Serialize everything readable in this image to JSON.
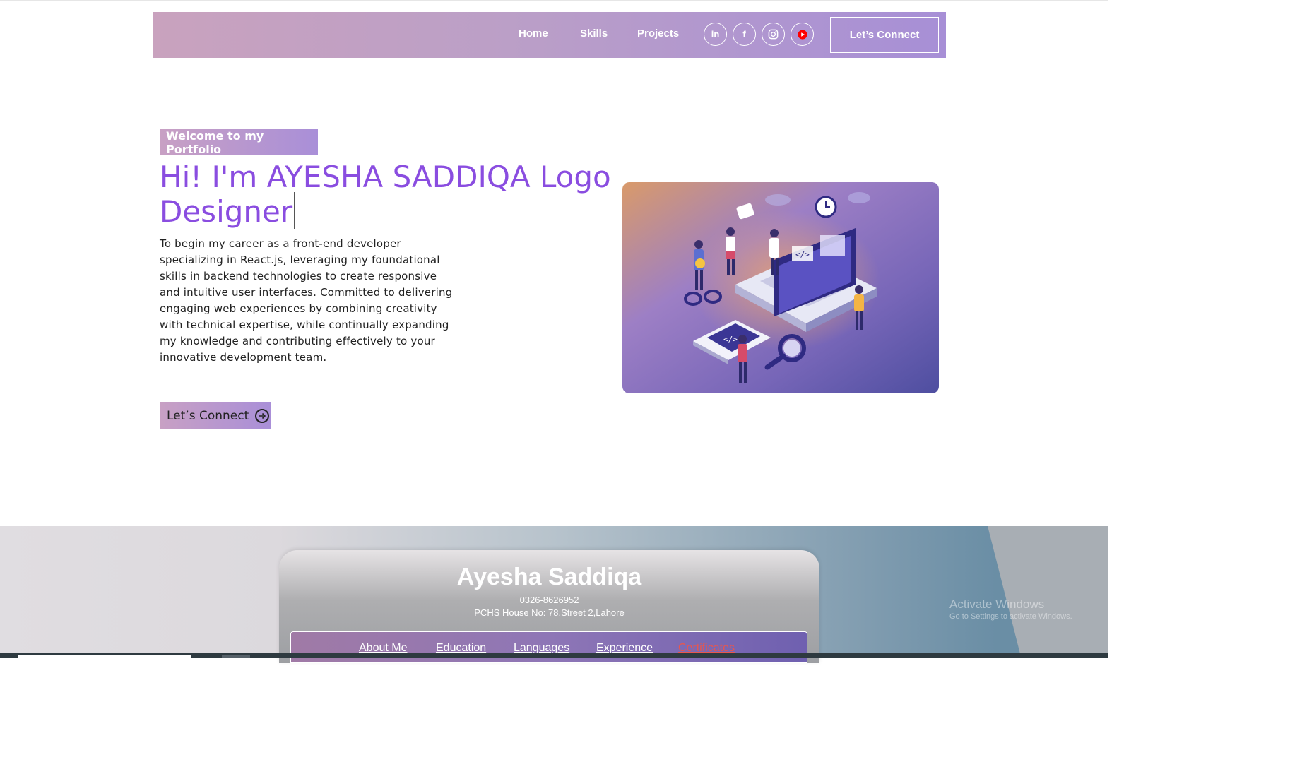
{
  "nav": {
    "links": [
      "Home",
      "Skills",
      "Projects"
    ],
    "social": [
      {
        "icon": "linkedin-icon",
        "glyph": "in"
      },
      {
        "icon": "facebook-icon",
        "glyph": "f"
      },
      {
        "icon": "instagram-icon"
      },
      {
        "icon": "youtube-icon"
      }
    ],
    "cta": "Let’s Connect"
  },
  "hero": {
    "badge": "Welcome to my Portfolio",
    "title": "Hi! I'm AYESHA SADDIQA Logo Designer",
    "description": "To begin my career as a front-end developer specializing in React.js, leveraging my foundational skills in backend technologies to create responsive and intuitive user interfaces. Committed to delivering engaging web experiences by combining creativity with technical expertise, while continually expanding my knowledge and contributing effectively to your innovative development team.",
    "cta": "Let’s Connect",
    "cta_icon": "arrow-circle-right-icon",
    "illustration": "developer-laptop-illustration",
    "code_glyph": "</>"
  },
  "profile": {
    "name": "Ayesha Saddiqa",
    "phone": "0326-8626952",
    "address": "PCHS House No: 78,Street 2,Lahore",
    "tabs": [
      "About Me",
      "Education",
      "Languages",
      "Experience",
      "Certificates"
    ],
    "active_tab": "Certificates"
  },
  "watermark": {
    "line1": "Activate Windows",
    "line2": "Go to Settings to activate Windows."
  },
  "colors": {
    "accent": "#8a4de0",
    "nav_gradient_start": "#c9a2be",
    "nav_gradient_end": "#a78fd6",
    "active_tab": "#e8564e"
  }
}
